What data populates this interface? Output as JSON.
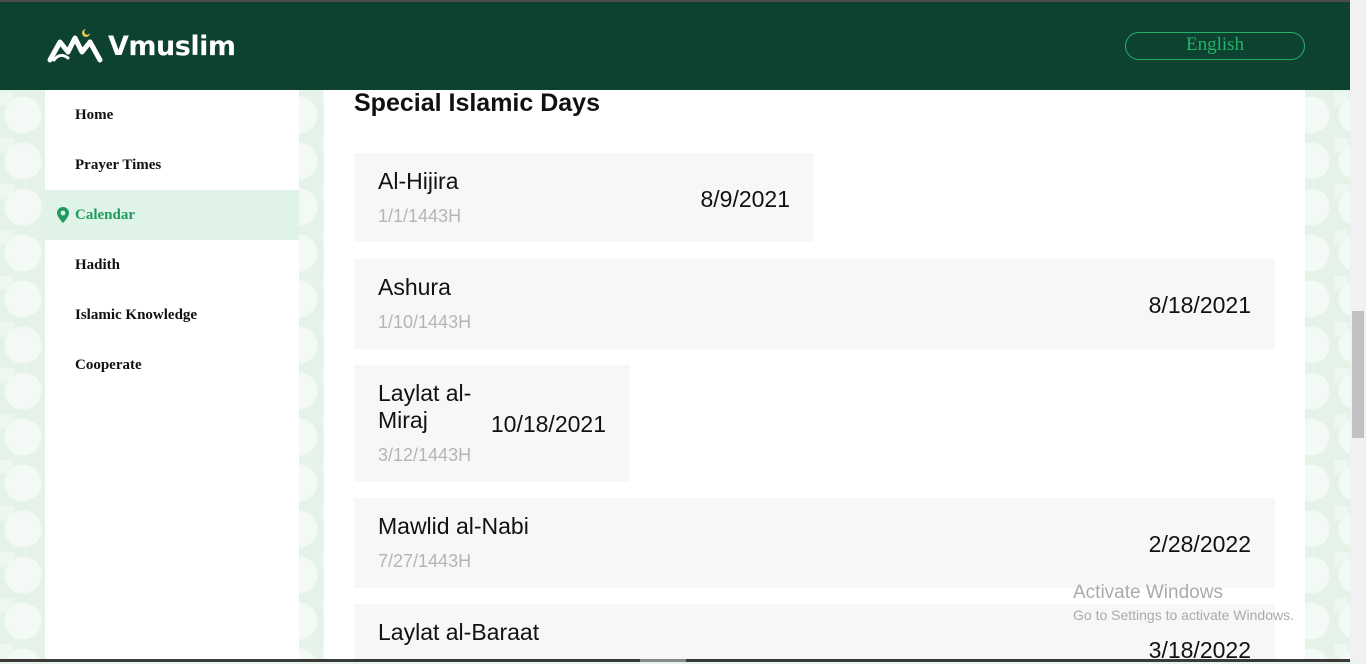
{
  "header": {
    "brand": "Vmuslim",
    "language_button": "English",
    "colors": {
      "bar": "#0e4230",
      "accent": "#21b36b"
    }
  },
  "sidebar": {
    "items": [
      {
        "label": "Home",
        "active": false
      },
      {
        "label": "Prayer Times",
        "active": false
      },
      {
        "label": "Calendar",
        "active": true,
        "icon": "location-pin-icon"
      },
      {
        "label": "Hadith",
        "active": false
      },
      {
        "label": "Islamic Knowledge",
        "active": false
      },
      {
        "label": "Cooperate",
        "active": false
      }
    ]
  },
  "main": {
    "title": "Special Islamic Days",
    "days": [
      {
        "name": "Al-Hijira",
        "hijri": "1/1/1443H",
        "date": "8/9/2021"
      },
      {
        "name": "Ashura",
        "hijri": "1/10/1443H",
        "date": "8/18/2021"
      },
      {
        "name_lines": [
          "Laylat al-",
          "Miraj"
        ],
        "hijri": "3/12/1443H",
        "date": "10/18/2021"
      },
      {
        "name": "Mawlid al-Nabi",
        "hijri": "7/27/1443H",
        "date": "2/28/2022"
      },
      {
        "name": "Laylat al-Baraat",
        "date": "3/18/2022"
      }
    ]
  },
  "watermark": {
    "line1": "Activate Windows",
    "line2": "Go to Settings to activate Windows."
  }
}
